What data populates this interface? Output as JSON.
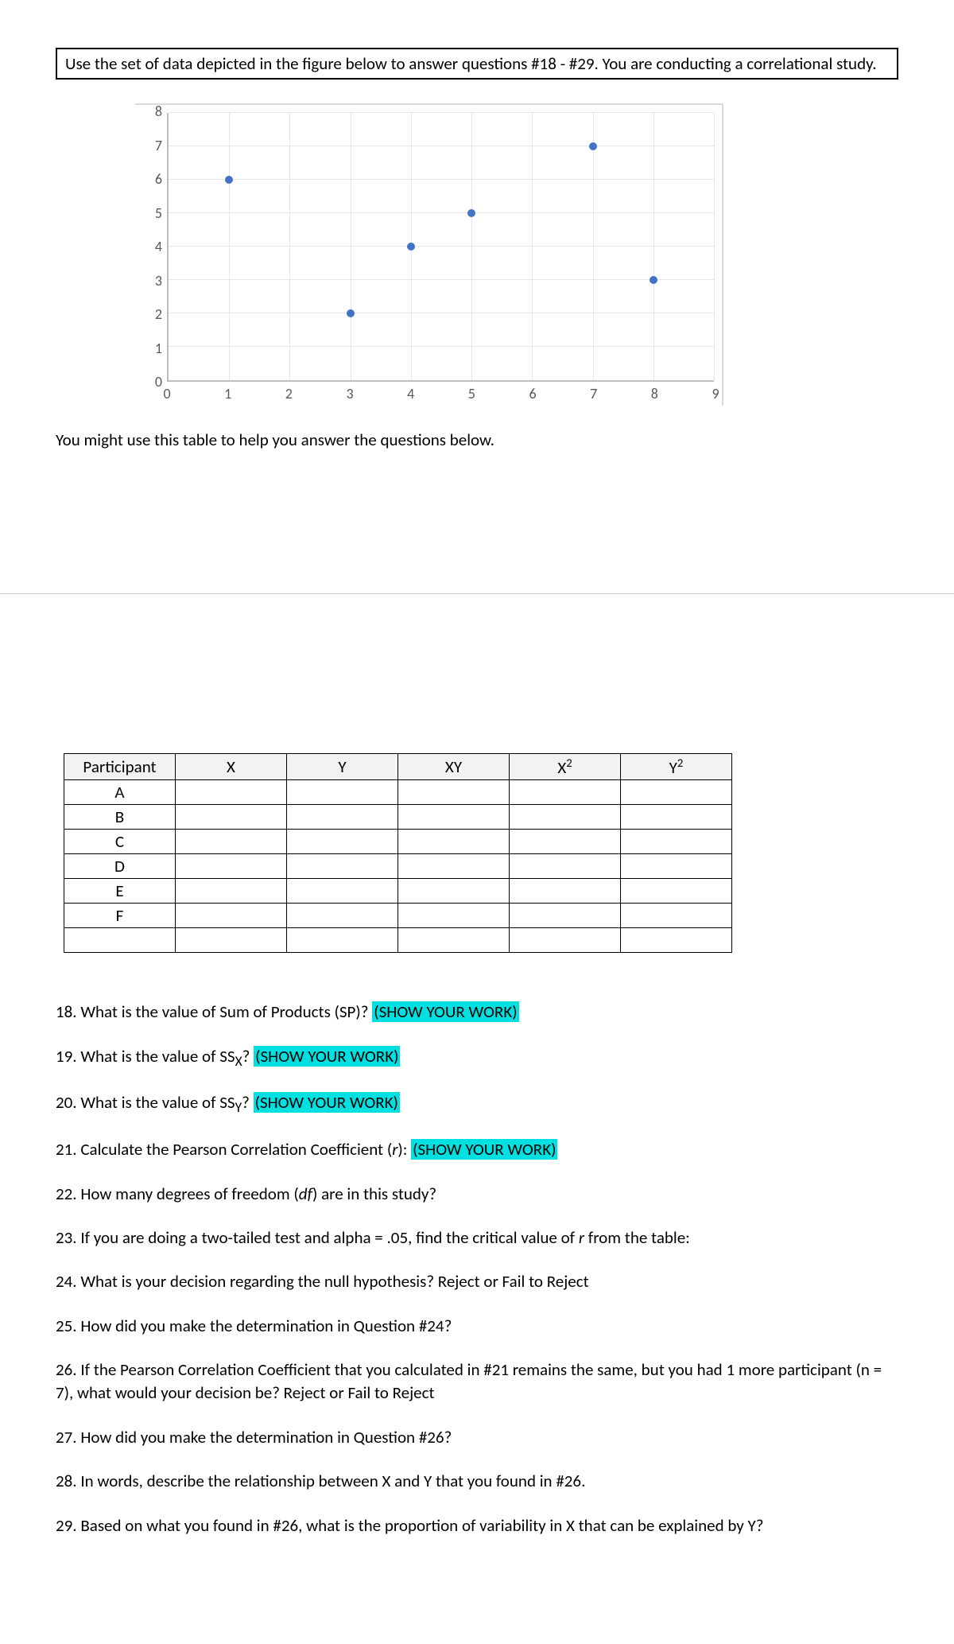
{
  "instruction": "Use the set of data depicted in the figure below to answer questions #18 - #29. You are conducting a correlational study.",
  "hint": "You might use this table to help you answer the questions below.",
  "chart_data": {
    "type": "scatter",
    "x": [
      1,
      3,
      4,
      5,
      7,
      8
    ],
    "y": [
      6,
      2,
      4,
      5,
      7,
      3
    ],
    "xlim": [
      0,
      9
    ],
    "ylim": [
      0,
      8
    ],
    "xticks": [
      0,
      1,
      2,
      3,
      4,
      5,
      6,
      7,
      8,
      9
    ],
    "yticks": [
      0,
      1,
      2,
      3,
      4,
      5,
      6,
      7,
      8
    ],
    "xlabel": "",
    "ylabel": "",
    "title": ""
  },
  "table": {
    "headers": [
      "Participant",
      "X",
      "Y",
      "XY",
      "X²",
      "Y²"
    ],
    "rows": [
      "A",
      "B",
      "C",
      "D",
      "E",
      "F"
    ]
  },
  "q18a": "18. What is the value of Sum of Products (SP)? ",
  "q18h": "(SHOW YOUR WORK)",
  "q19a": "19. What is the value of SS",
  "q19sub": "X",
  "q19b": "? ",
  "q19h": "(SHOW YOUR WORK)",
  "q20a": "20. What is the value of SS",
  "q20sub": "Y",
  "q20b": "? ",
  "q20h": "(SHOW YOUR WORK)",
  "q21a": "21. Calculate the Pearson Correlation Coefficient (",
  "q21r": "r",
  "q21b": "): ",
  "q21h": "(SHOW YOUR WORK)",
  "q22a": "22. How many degrees of freedom (",
  "q22df": "df",
  "q22b": ") are in this study?",
  "q23a": "23. If you are doing a two-tailed test and alpha = .05, find the critical value of ",
  "q23r": "r",
  "q23b": " from the table:",
  "q24": "24. What is your decision regarding the null hypothesis? Reject or Fail to Reject",
  "q25": "25. How did you make the determination in Question #24?",
  "q26": "26. If the Pearson Correlation Coefficient that you calculated in #21 remains the same, but you had 1 more participant (n = 7), what would your decision be? Reject or Fail to Reject",
  "q27": "27. How did you make the determination in Question #26?",
  "q28": "28. In words, describe the relationship between X and Y that you found in #26.",
  "q29": "29. Based on what you found in #26, what is the proportion of variability in X that can be explained by Y?"
}
